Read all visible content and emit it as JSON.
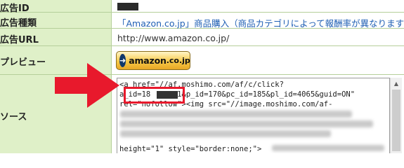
{
  "rows": {
    "ad_id": {
      "label": "広告ID"
    },
    "ad_type": {
      "label": "広告種類",
      "value": "「Amazon.co.jp」商品購入（商品カテゴリによって報酬率が異なります）"
    },
    "ad_url": {
      "label": "広告URL",
      "value": "http://www.amazon.co.jp/"
    },
    "preview": {
      "label": "プレビュー",
      "button": {
        "brand": "amazon",
        "tld": ".co.jp"
      }
    },
    "source": {
      "label": "ソース",
      "code_lines": [
        "<a href=\"//af.moshimo.com/af/c/click?",
        "a_id=18      1&p_id=170&pc_id=185&pl_id=4065&guid=ON\"",
        "rel=\"nofollow\"><img src=\"//image.moshimo.com/af-",
        "",
        "",
        "",
        "",
        "height=\"1\" style=\"border:none;\">"
      ]
    }
  },
  "colors": {
    "label_bg": "#dff0c8",
    "grid": "#b5cf9a",
    "link": "#1f5fb4",
    "highlight": "#e8192c",
    "amazon_yellow": "#f7c948",
    "amazon_navy": "#10386b"
  }
}
